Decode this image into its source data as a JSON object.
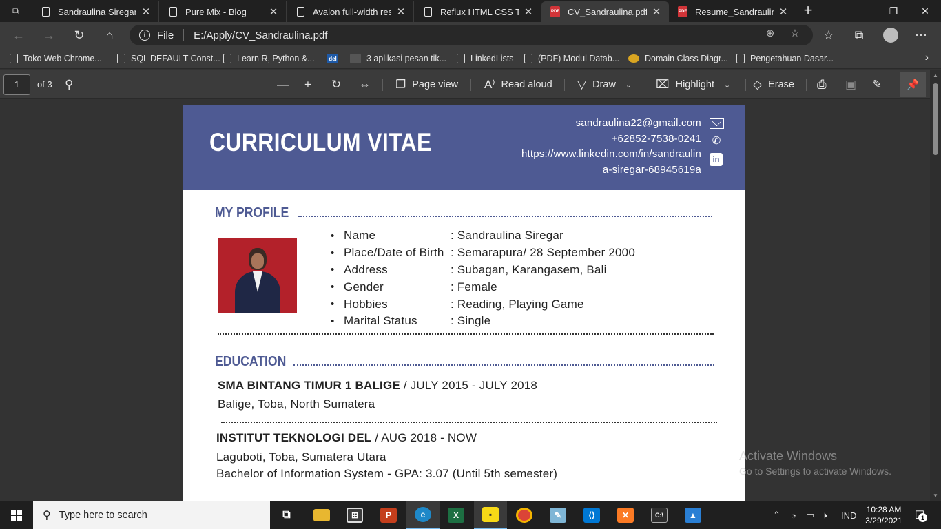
{
  "tabs": [
    {
      "title": "Sandraulina Siregar",
      "type": "doc"
    },
    {
      "title": "Pure Mix - Blog",
      "type": "doc"
    },
    {
      "title": "Avalon full-width resp",
      "type": "doc"
    },
    {
      "title": "Reflux HTML CSS Tem",
      "type": "doc"
    },
    {
      "title": "CV_Sandraulina.pdf",
      "type": "pdf",
      "active": true
    },
    {
      "title": "Resume_Sandraulina.p",
      "type": "pdf"
    }
  ],
  "address": {
    "scheme": "File",
    "url": "E:/Apply/CV_Sandraulina.pdf"
  },
  "favorites": [
    "Toko Web Chrome...",
    "SQL DEFAULT Const...",
    "Learn R, Python &...",
    "3 aplikasi pesan tik...",
    "LinkedLists",
    "(PDF) Modul Datab...",
    "Domain Class Diagr...",
    "Pengetahuan Dasar..."
  ],
  "pdf_toolbar": {
    "page": "1",
    "total": "of 3",
    "page_view": "Page view",
    "read_aloud": "Read aloud",
    "draw": "Draw",
    "highlight": "Highlight",
    "erase": "Erase"
  },
  "cv": {
    "title": "CURRICULUM VITAE",
    "email": "sandraulina22@gmail.com",
    "phone": "+62852-7538-0241",
    "linkedin_1": "https://www.linkedin.com/in/sandraulin",
    "linkedin_2": "a-siregar-68945619a",
    "profile_title": "MY PROFILE",
    "profile": [
      {
        "key": "Name",
        "value": ": Sandraulina Siregar"
      },
      {
        "key": "Place/Date of Birth",
        "value": ": Semarapura/ 28 September 2000"
      },
      {
        "key": "Address",
        "value": ": Subagan, Karangasem, Bali"
      },
      {
        "key": "Gender",
        "value": ": Female"
      },
      {
        "key": "Hobbies",
        "value": ": Reading, Playing Game"
      },
      {
        "key": "Marital Status",
        "value": ": Single"
      }
    ],
    "education_title": "EDUCATION",
    "edu1_school": "SMA BINTANG TIMUR 1 BALIGE",
    "edu1_period": " / JULY 2015 - JULY 2018",
    "edu1_location": "Balige, Toba, North Sumatera",
    "edu2_school": "INSTITUT TEKNOLOGI DEL",
    "edu2_period": " / AUG 2018 - NOW",
    "edu2_location": "Laguboti, Toba, Sumatera Utara",
    "edu2_program": "Bachelor of Information System - GPA: 3.07 (Until 5th semester)"
  },
  "watermark": {
    "line1": "Activate Windows",
    "line2": "Go to Settings to activate Windows."
  },
  "taskbar": {
    "search_placeholder": "Type here to search",
    "lang": "IND",
    "time": "10:28 AM",
    "date": "3/29/2021",
    "notifications": "1"
  },
  "colors": {
    "cv_accent": "#4e5a93",
    "browser_dark": "#202020"
  }
}
